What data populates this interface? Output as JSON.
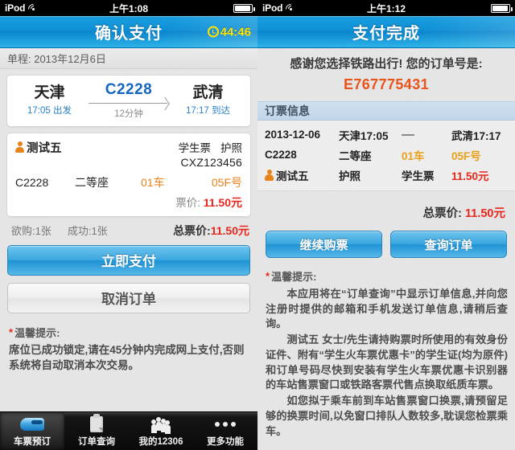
{
  "left": {
    "status_bar": {
      "carrier": "iPod",
      "time": "上午1:08",
      "wifi_icon": "wifi-icon",
      "battery_icon": "battery-icon"
    },
    "nav": {
      "title": "确认支付",
      "timer": "44:46",
      "timer_icon": "clock-icon"
    },
    "trip_bar": "单程: 2013年12月6日",
    "route": {
      "from_city": "天津",
      "from_time": "17:05 出发",
      "train_no": "C2228",
      "duration": "12分钟",
      "to_city": "武清",
      "to_time": "17:17 到达"
    },
    "passenger": {
      "person_icon": "person-icon",
      "name": "测试五",
      "ticket_type": "学生票",
      "id_type": "护照",
      "id_number": "CXZ123456",
      "train_no": "C2228",
      "seat_class": "二等座",
      "carriage": "01车",
      "seat": "05F号",
      "fare_label": "票价:",
      "fare_value": "11.50元"
    },
    "totals": {
      "want": "欲购:1张",
      "success": "成功:1张",
      "total_label": "总票价:",
      "total_value": "11.50元"
    },
    "buttons": {
      "pay": "立即支付",
      "cancel": "取消订单"
    },
    "tips": {
      "title": "温馨提示:",
      "body": "席位已成功锁定,请在45分钟内完成网上支付,否则系统将自动取消本次交易。"
    }
  },
  "tabbar": {
    "items": [
      {
        "label": "车票预订",
        "icon": "train-icon",
        "active": true
      },
      {
        "label": "订单查询",
        "icon": "clipboard-icon",
        "active": false
      },
      {
        "label": "我的12306",
        "icon": "people-icon",
        "active": false
      },
      {
        "label": "更多功能",
        "icon": "ellipsis-icon",
        "active": false
      }
    ]
  },
  "right": {
    "status_bar": {
      "carrier": "iPod",
      "time": "上午1:12",
      "wifi_icon": "wifi-icon",
      "battery_icon": "battery-icon"
    },
    "nav": {
      "title": "支付完成"
    },
    "thanks": "感谢您选择铁路出行! 您的订单号是:",
    "order_no": "E767775431",
    "section_title": "订票信息",
    "info": {
      "date": "2013-12-06",
      "from": "天津17:05",
      "to": "武清17:17",
      "train_no": "C2228",
      "seat_class": "二等座",
      "carriage": "01车",
      "seat": "05F号",
      "person_icon": "person-icon",
      "name": "测试五",
      "id_type": "护照",
      "ticket_type": "学生票",
      "fare": "11.50元"
    },
    "total_label": "总票价:",
    "total_value": "11.50元",
    "buttons": {
      "continue": "继续购票",
      "query": "查询订单"
    },
    "tips": {
      "title": "温馨提示:",
      "p1": "本应用将在“订单查询”中显示订单信息,并向您注册时提供的邮箱和手机发送订单信息,请稍后查询。",
      "p2": "测试五 女士/先生请持购票时所使用的有效身份证件、附有“学生火车票优惠卡”的学生证(均为原件)和订单号码尽快到安装有学生火车票优惠卡识别器的车站售票窗口或铁路客票代售点换取纸质车票。",
      "p3": "如您拟于乘车前到车站售票窗口换票,请预留足够的换票时间,以免窗口排队人数较多,耽误您检票乘车。"
    }
  },
  "colors": {
    "nav_blue": "#0d8fd6",
    "accent_orange": "#e8821a",
    "accent_red": "#e8261c",
    "link_blue": "#1566c0",
    "timer_yellow": "#ffe400"
  }
}
